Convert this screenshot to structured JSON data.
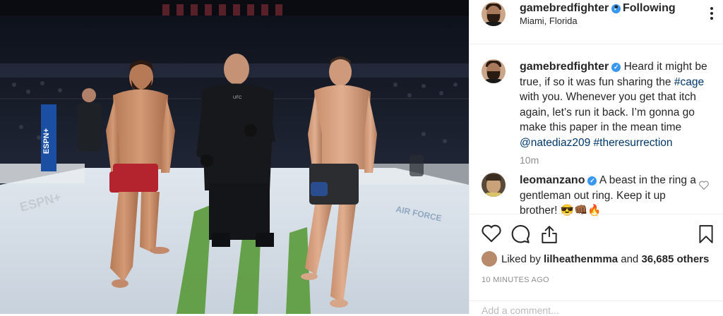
{
  "post": {
    "author": "gamebredfighter",
    "follow_label": "Following",
    "separator": "•",
    "location": "Miami, Florida",
    "verified_icon": "verified-badge-icon"
  },
  "caption": {
    "author": "gamebredfighter",
    "text_before": "Heard it might be true, if so it was fun sharing the ",
    "hashtag_cage": "#cage",
    "text_middle": " with you. Whenever you get that itch again, let’s run it back. I’m gonna go make this paper in the mean time ",
    "mention": "@natediaz209",
    "space": " ",
    "hashtag_resurrection": "#theresurrection",
    "time": "10m"
  },
  "comment": {
    "author": "leomanzano",
    "text": "A beast in the ring a gentleman out ring. Keep it up brother! 😎👊🏾🔥"
  },
  "actions": {
    "like_icon": "heart-icon",
    "comment_icon": "comment-icon",
    "share_icon": "share-icon",
    "save_icon": "bookmark-icon"
  },
  "likes": {
    "prefix": "Liked by ",
    "user": "lilheathenmma",
    "middle": " and ",
    "count": "36,685 others"
  },
  "timestamp": "10 MINUTES AGO",
  "add_comment_placeholder": "Add a comment...",
  "colors": {
    "link": "#00376b",
    "verified": "#3897f0",
    "muted": "#8e8e8e",
    "text": "#262626"
  }
}
